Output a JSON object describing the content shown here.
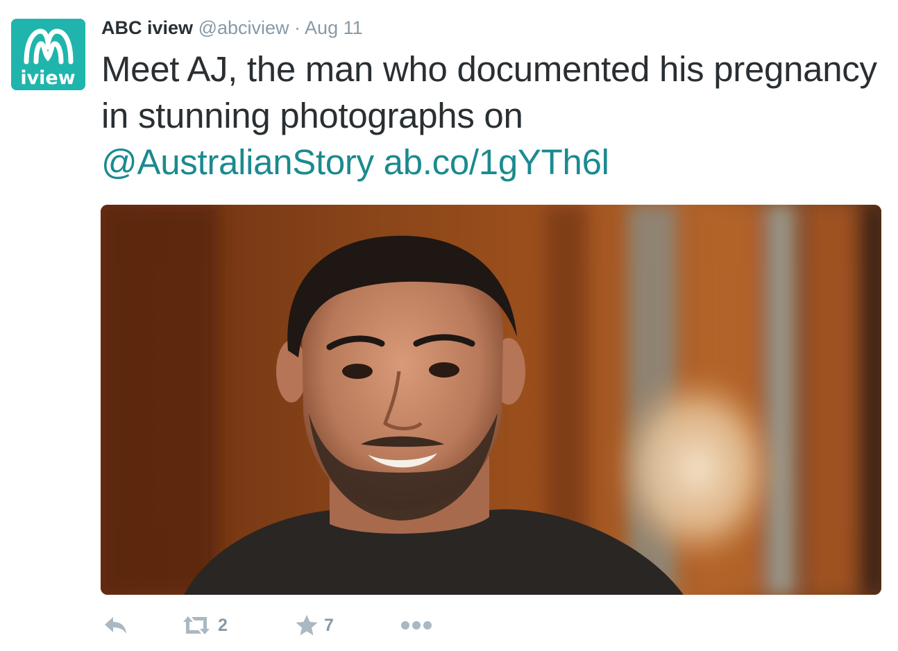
{
  "tweet": {
    "author_name": "ABC iview",
    "handle": "@abciview",
    "separator": "·",
    "date": "Aug 11",
    "avatar_label": "iview",
    "text_plain": "Meet AJ, the man who documented his pregnancy in stunning photographs on",
    "mention": "@AustralianStory",
    "link": "ab.co/1gYTh6l",
    "media_alt": "photo",
    "actions": {
      "reply_icon": "reply-icon",
      "retweet_icon": "retweet-icon",
      "retweet_count": "2",
      "favorite_icon": "star-icon",
      "favorite_count": "7",
      "more_icon": "more-icon"
    }
  },
  "colors": {
    "brand": "#1fb5ad",
    "link": "#1b8a8f",
    "text": "#292f33",
    "muted": "#8899a6"
  }
}
